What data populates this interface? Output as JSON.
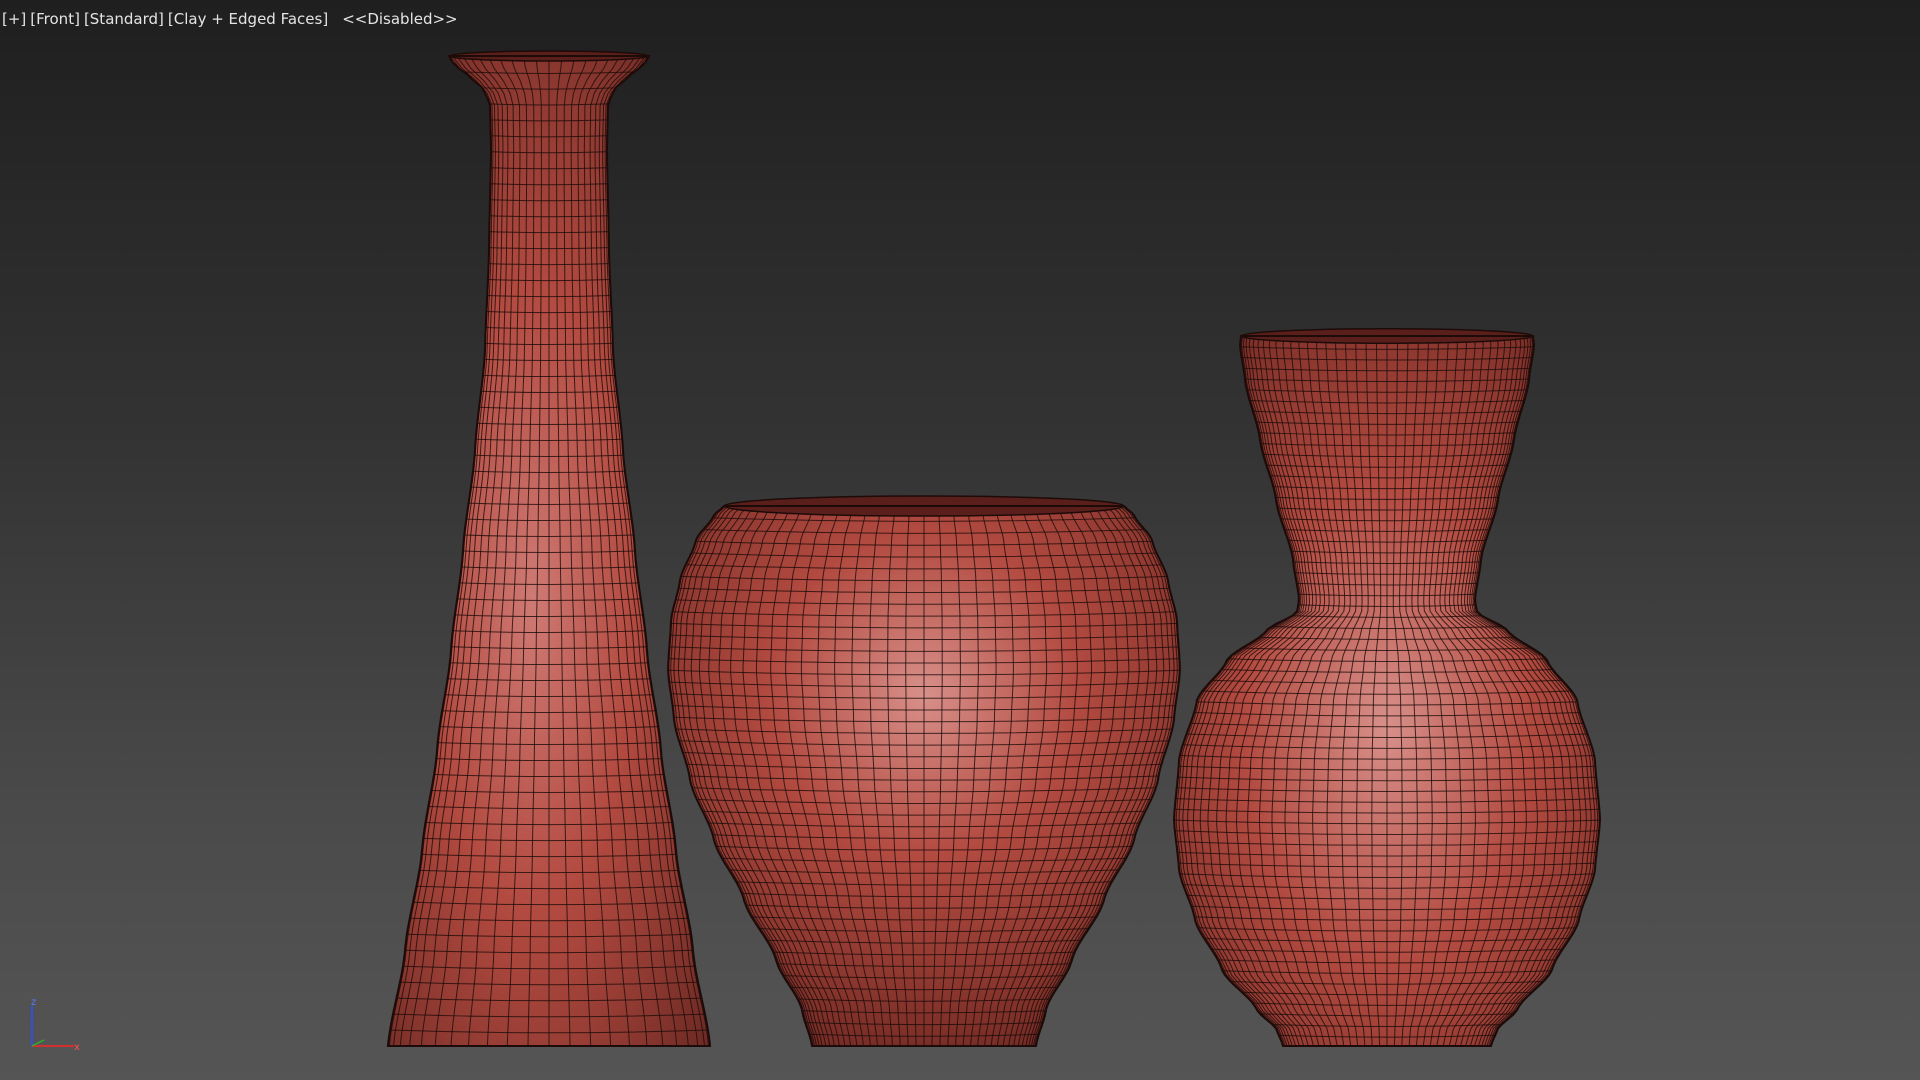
{
  "viewport": {
    "labels": {
      "menu": "[+]",
      "view": "[Front]",
      "mode": "[Standard]",
      "shading": "[Clay + Edged Faces]",
      "status": "<<Disabled>>"
    }
  },
  "axis": {
    "z_label": "z",
    "x_label": "x"
  },
  "colors": {
    "background_top": "#1f1f1f",
    "background_bottom": "#555555",
    "clay_base": "#b24a40",
    "clay_highlight": "#cf7a74",
    "clay_shadow": "#6e2a24",
    "wire": "#1d0b09",
    "axis_x": "#d03030",
    "axis_y": "#30b030",
    "axis_z": "#3050e0"
  },
  "objects": [
    {
      "name": "tall-bottle-vase"
    },
    {
      "name": "round-bowl-vase"
    },
    {
      "name": "flared-neck-vase"
    }
  ]
}
